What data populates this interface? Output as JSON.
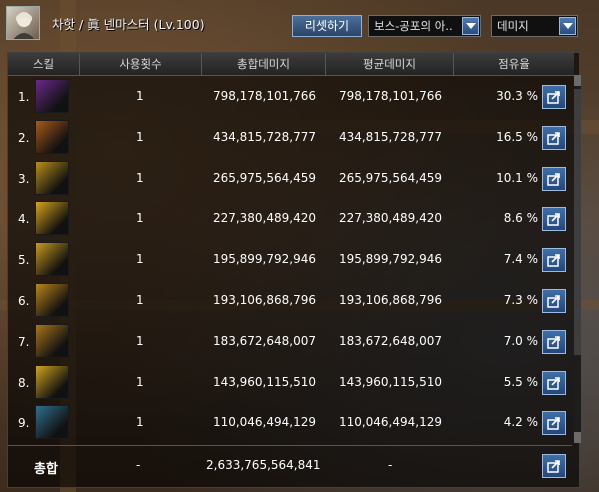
{
  "header": {
    "character_name": "차핫 / 眞 넨마스터 (Lv.100)",
    "reset_label": "리셋하기",
    "target_select": "보스-공포의 아..",
    "metric_select": "데미지"
  },
  "table": {
    "columns": [
      "스킬",
      "사용횟수",
      "총합데미지",
      "평균데미지",
      "점유율"
    ],
    "rows": [
      {
        "rank": "1.",
        "skill_icon": "purple-dragon-skill-icon",
        "uses": "1",
        "total": "798,178,101,766",
        "avg": "798,178,101,766",
        "share": "30.3 %",
        "color": "#6a2a8a"
      },
      {
        "rank": "2.",
        "skill_icon": "fire-orb-skill-icon",
        "uses": "1",
        "total": "434,815,728,777",
        "avg": "434,815,728,777",
        "share": "16.5 %",
        "color": "#a85a18"
      },
      {
        "rank": "3.",
        "skill_icon": "lion-face-skill-icon",
        "uses": "1",
        "total": "265,975,564,459",
        "avg": "265,975,564,459",
        "share": "10.1 %",
        "color": "#b8901c"
      },
      {
        "rank": "4.",
        "skill_icon": "golden-burst-skill-icon",
        "uses": "1",
        "total": "227,380,489,420",
        "avg": "227,380,489,420",
        "share": "8.6 %",
        "color": "#d6a41c"
      },
      {
        "rank": "5.",
        "skill_icon": "golden-dragon-skill-icon",
        "uses": "1",
        "total": "195,899,792,946",
        "avg": "195,899,792,946",
        "share": "7.4 %",
        "color": "#c89a20"
      },
      {
        "rank": "6.",
        "skill_icon": "dragon-spiral-skill-icon",
        "uses": "1",
        "total": "193,106,868,796",
        "avg": "193,106,868,796",
        "share": "7.3 %",
        "color": "#b9861a"
      },
      {
        "rank": "7.",
        "skill_icon": "flame-dragon-skill-icon",
        "uses": "1",
        "total": "183,672,648,007",
        "avg": "183,672,648,007",
        "share": "7.0 %",
        "color": "#a8761a"
      },
      {
        "rank": "8.",
        "skill_icon": "figure-aura-skill-icon",
        "uses": "1",
        "total": "143,960,115,510",
        "avg": "143,960,115,510",
        "share": "5.5 %",
        "color": "#d0a420"
      },
      {
        "rank": "9.",
        "skill_icon": "blue-kick-skill-icon",
        "uses": "1",
        "total": "110,046,494,129",
        "avg": "110,046,494,129",
        "share": "4.2 %",
        "color": "#2f6f8f"
      }
    ]
  },
  "total": {
    "label": "총합",
    "uses": "-",
    "total": "2,633,765,564,841",
    "avg": "-"
  }
}
